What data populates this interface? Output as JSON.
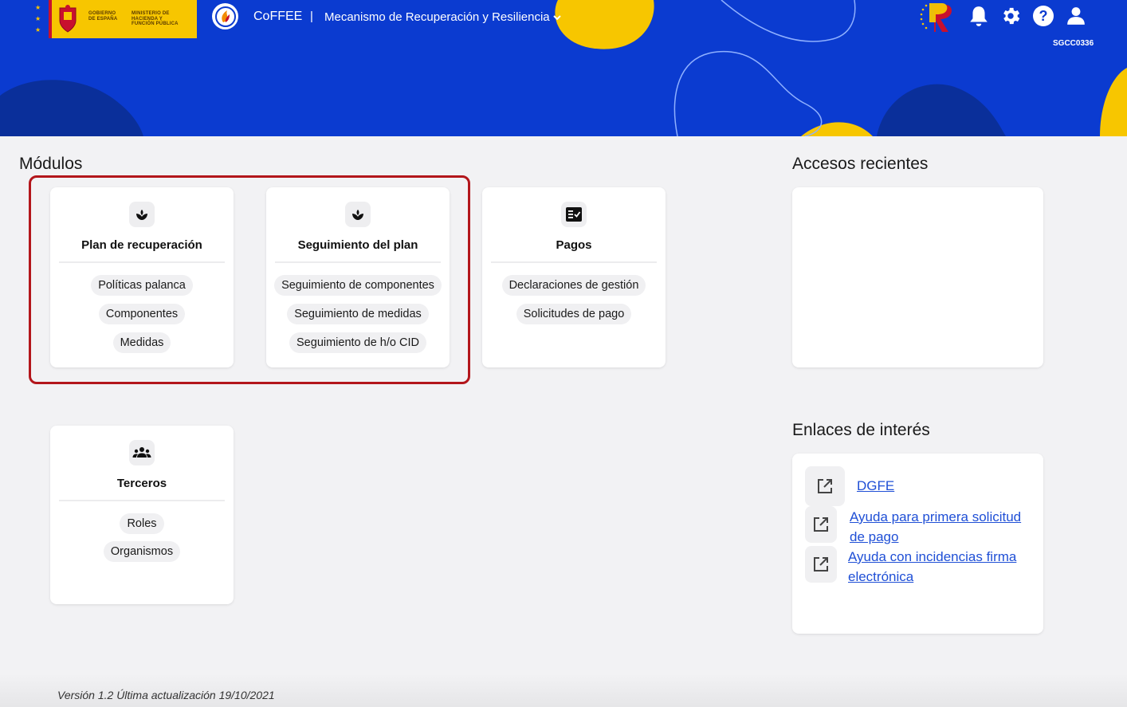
{
  "header": {
    "gov_logo_text_1": "Gobierno de España",
    "gov_logo_text_2": "Ministerio de Hacienda y Función Pública",
    "app_name": "CoFFEE",
    "separator": "|",
    "context": "Mecanismo de Recuperación y Resiliencia",
    "user_code": "SGCC0336",
    "icons": [
      "prtr-logo",
      "bell-icon",
      "gear-icon",
      "help-icon",
      "user-icon"
    ],
    "colors": {
      "header_bg": "#0b3bd0",
      "accent_yellow": "#f7c600"
    }
  },
  "modules": {
    "title": "Módulos",
    "cards": [
      {
        "icon": "plant-icon",
        "title": "Plan de recuperación",
        "items": [
          "Políticas palanca",
          "Componentes",
          "Medidas"
        ]
      },
      {
        "icon": "plant-icon",
        "title": "Seguimiento del plan",
        "items": [
          "Seguimiento de componentes",
          "Seguimiento de medidas",
          "Seguimiento de h/o CID"
        ]
      },
      {
        "icon": "checklist-icon",
        "title": "Pagos",
        "items": [
          "Declaraciones de gestión",
          "Solicitudes de pago"
        ]
      },
      {
        "icon": "group-icon",
        "title": "Terceros",
        "items": [
          "Roles",
          "Organismos"
        ]
      }
    ]
  },
  "recent": {
    "title": "Accesos recientes"
  },
  "links": {
    "title": "Enlaces de interés",
    "items": [
      {
        "icon": "external-link-icon",
        "label": "DGFE"
      },
      {
        "icon": "external-link-icon",
        "label": "Ayuda para primera solicitud de pago"
      },
      {
        "icon": "external-link-icon",
        "label": "Ayuda con incidencias firma electrónica"
      }
    ],
    "link_color": "#1f4fd6"
  },
  "footer": {
    "version": "Versión 1.2 Última actualización 19/10/2021"
  }
}
